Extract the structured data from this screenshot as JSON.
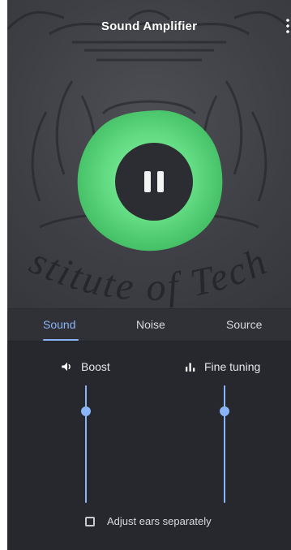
{
  "app": {
    "title": "Sound Amplifier"
  },
  "watermark": {
    "text": "stitute of Tech"
  },
  "player": {
    "state": "paused",
    "visualizer_color": "#5fd67f"
  },
  "tabs": [
    {
      "label": "Sound",
      "active": true
    },
    {
      "label": "Noise",
      "active": false
    },
    {
      "label": "Source",
      "active": false
    }
  ],
  "controls": {
    "boost": {
      "label": "Boost",
      "icon": "volume-icon",
      "level": 0.78
    },
    "fine_tuning": {
      "label": "Fine tuning",
      "icon": "equalizer-icon",
      "level": 0.78
    },
    "adjust_ears": {
      "label": "Adjust ears separately",
      "checked": false
    }
  },
  "colors": {
    "accent": "#8ab4f8",
    "background": "#2a2c31",
    "blob_green": "#5fd67f"
  }
}
